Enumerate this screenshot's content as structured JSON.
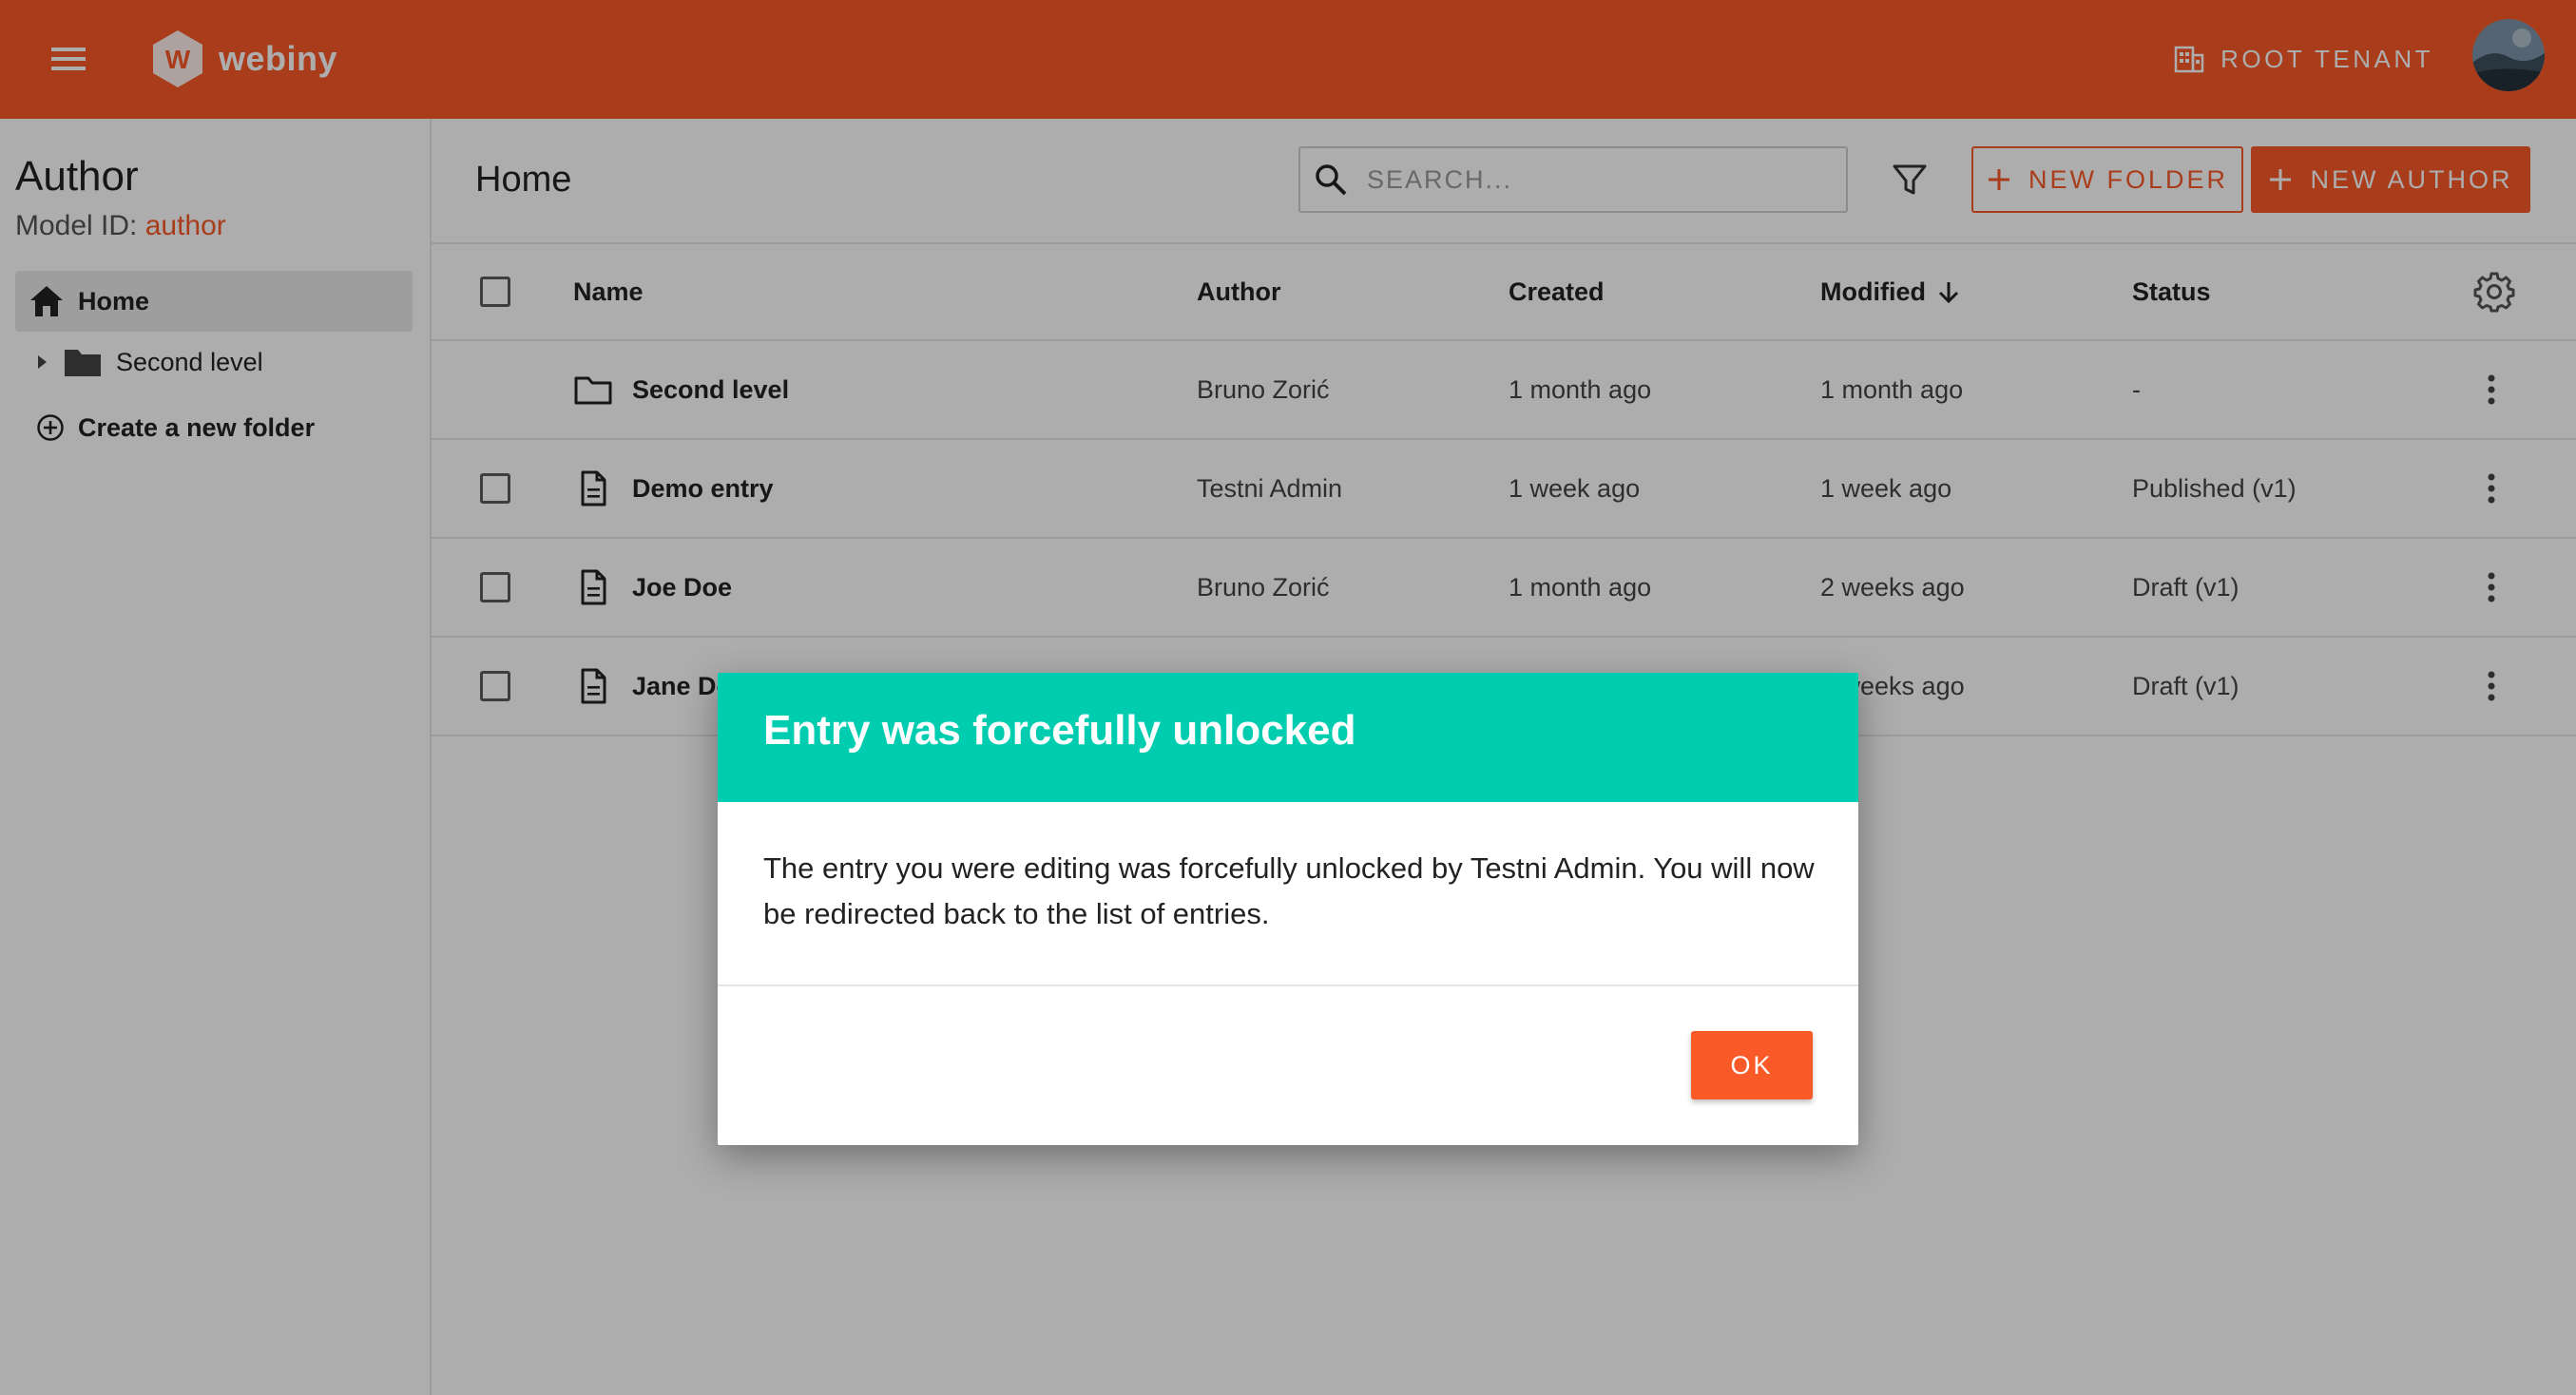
{
  "app": {
    "logo_text": "webiny",
    "tenant_label": "ROOT TENANT"
  },
  "sidebar": {
    "model_title": "Author",
    "model_id_label": "Model ID: ",
    "model_id_value": "author",
    "items": [
      {
        "label": "Home",
        "icon": "home-icon",
        "selected": true
      },
      {
        "label": "Second level",
        "icon": "folder-icon",
        "selected": false
      },
      {
        "label": "Create a new folder",
        "icon": "add-circle-icon",
        "selected": false
      }
    ]
  },
  "header": {
    "title": "Home",
    "search_placeholder": "SEARCH...",
    "new_folder_label": "NEW FOLDER",
    "new_entry_label": "NEW AUTHOR"
  },
  "table": {
    "columns": [
      "Name",
      "Author",
      "Created",
      "Modified",
      "Status"
    ],
    "sort": {
      "column": "Modified",
      "direction": "desc"
    },
    "rows": [
      {
        "type": "folder",
        "name": "Second level",
        "author": "Bruno Zorić",
        "created": "1 month ago",
        "modified": "1 month ago",
        "status": "-"
      },
      {
        "type": "entry",
        "name": "Demo entry",
        "author": "Testni Admin",
        "created": "1 week ago",
        "modified": "1 week ago",
        "status": "Published (v1)"
      },
      {
        "type": "entry",
        "name": "Joe Doe",
        "author": "Bruno Zorić",
        "created": "1 month ago",
        "modified": "2 weeks ago",
        "status": "Draft (v1)"
      },
      {
        "type": "entry",
        "name": "Jane Doe",
        "author": "",
        "created": "",
        "modified": "2 weeks ago",
        "status": "Draft (v1)"
      }
    ]
  },
  "dialog": {
    "title": "Entry was forcefully unlocked",
    "message": "The entry you were editing was forcefully unlocked by Testni Admin. You will now be redirected back to the list of entries.",
    "ok_label": "OK"
  },
  "colors": {
    "brand": "#fa5a28",
    "dialog_header": "#00ccb0"
  }
}
